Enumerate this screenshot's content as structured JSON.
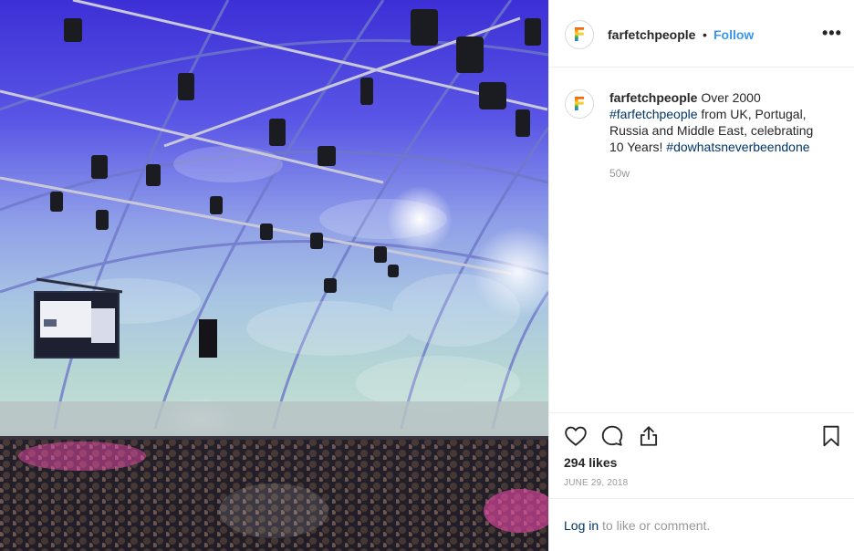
{
  "colors": {
    "follow_blue": "#3897f0",
    "hashtag_blue": "#003569",
    "muted_gray": "#999999",
    "text": "#262626",
    "divider": "#efefef"
  },
  "photo": {
    "icon": "concert-tent-photo"
  },
  "header": {
    "avatar_icon": "farfetch-f-logo",
    "avatar_letter": "F",
    "username": "farfetchpeople",
    "separator": "•",
    "follow_label": "Follow",
    "more_icon": "more-horizontal-icon",
    "more_label": "•••"
  },
  "caption": {
    "avatar_letter": "F",
    "username": "farfetchpeople",
    "text_1": "Over 2000",
    "hashtag_1": "#farfetchpeople",
    "text_2": "from UK, Portugal, Russia and Middle East, celebrating 10 Years!",
    "hashtag_2": "#dowhatsneverbeendone",
    "age": "50w"
  },
  "actions": {
    "like_icon": "heart-icon",
    "comment_icon": "comment-icon",
    "share_icon": "share-icon",
    "save_icon": "bookmark-icon",
    "likes": "294 likes",
    "date": "JUNE 29, 2018"
  },
  "comment_bar": {
    "login_label": "Log in",
    "suffix": " to like or comment."
  }
}
